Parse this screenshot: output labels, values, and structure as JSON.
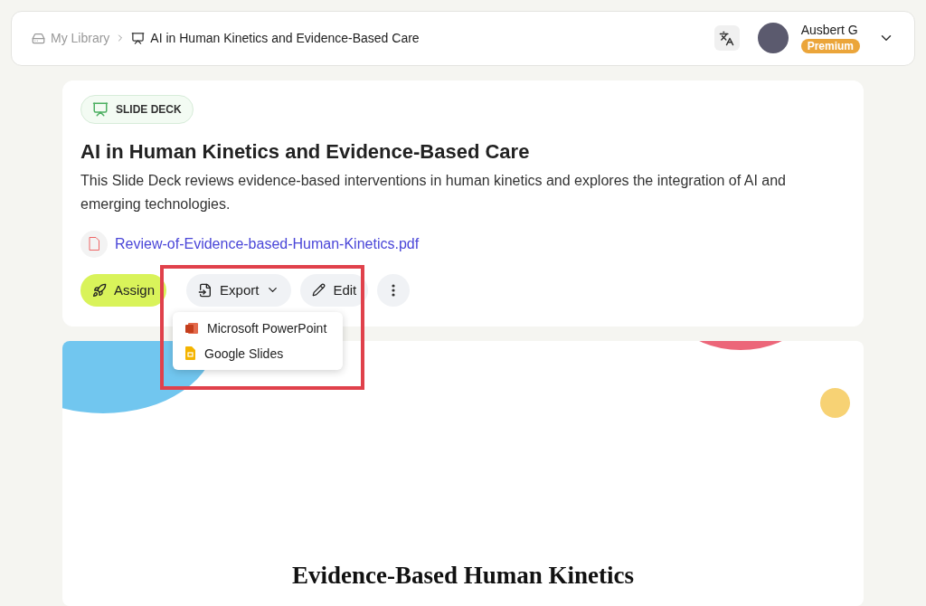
{
  "breadcrumb": [
    {
      "label": "My Library",
      "current": false
    },
    {
      "label": "AI in Human Kinetics and Evidence-Based Care",
      "current": true
    }
  ],
  "user": {
    "name": "Ausbert G",
    "badge": "Premium"
  },
  "item": {
    "tag": "SLIDE DECK",
    "title": "AI in Human Kinetics and Evidence-Based Care",
    "description": "This Slide Deck reviews evidence-based interventions in human kinetics and explores the integration of AI and emerging technologies.",
    "file": "Review-of-Evidence-based-Human-Kinetics.pdf"
  },
  "actions": {
    "assign": "Assign",
    "export": {
      "label": "Export",
      "expanded": true,
      "items": [
        {
          "label": "Microsoft PowerPoint",
          "kind": "powerpoint"
        },
        {
          "label": "Google Slides",
          "kind": "slides"
        }
      ]
    },
    "edit": "Edit"
  },
  "slide": {
    "title": "Evidence-Based Human Kinetics"
  }
}
